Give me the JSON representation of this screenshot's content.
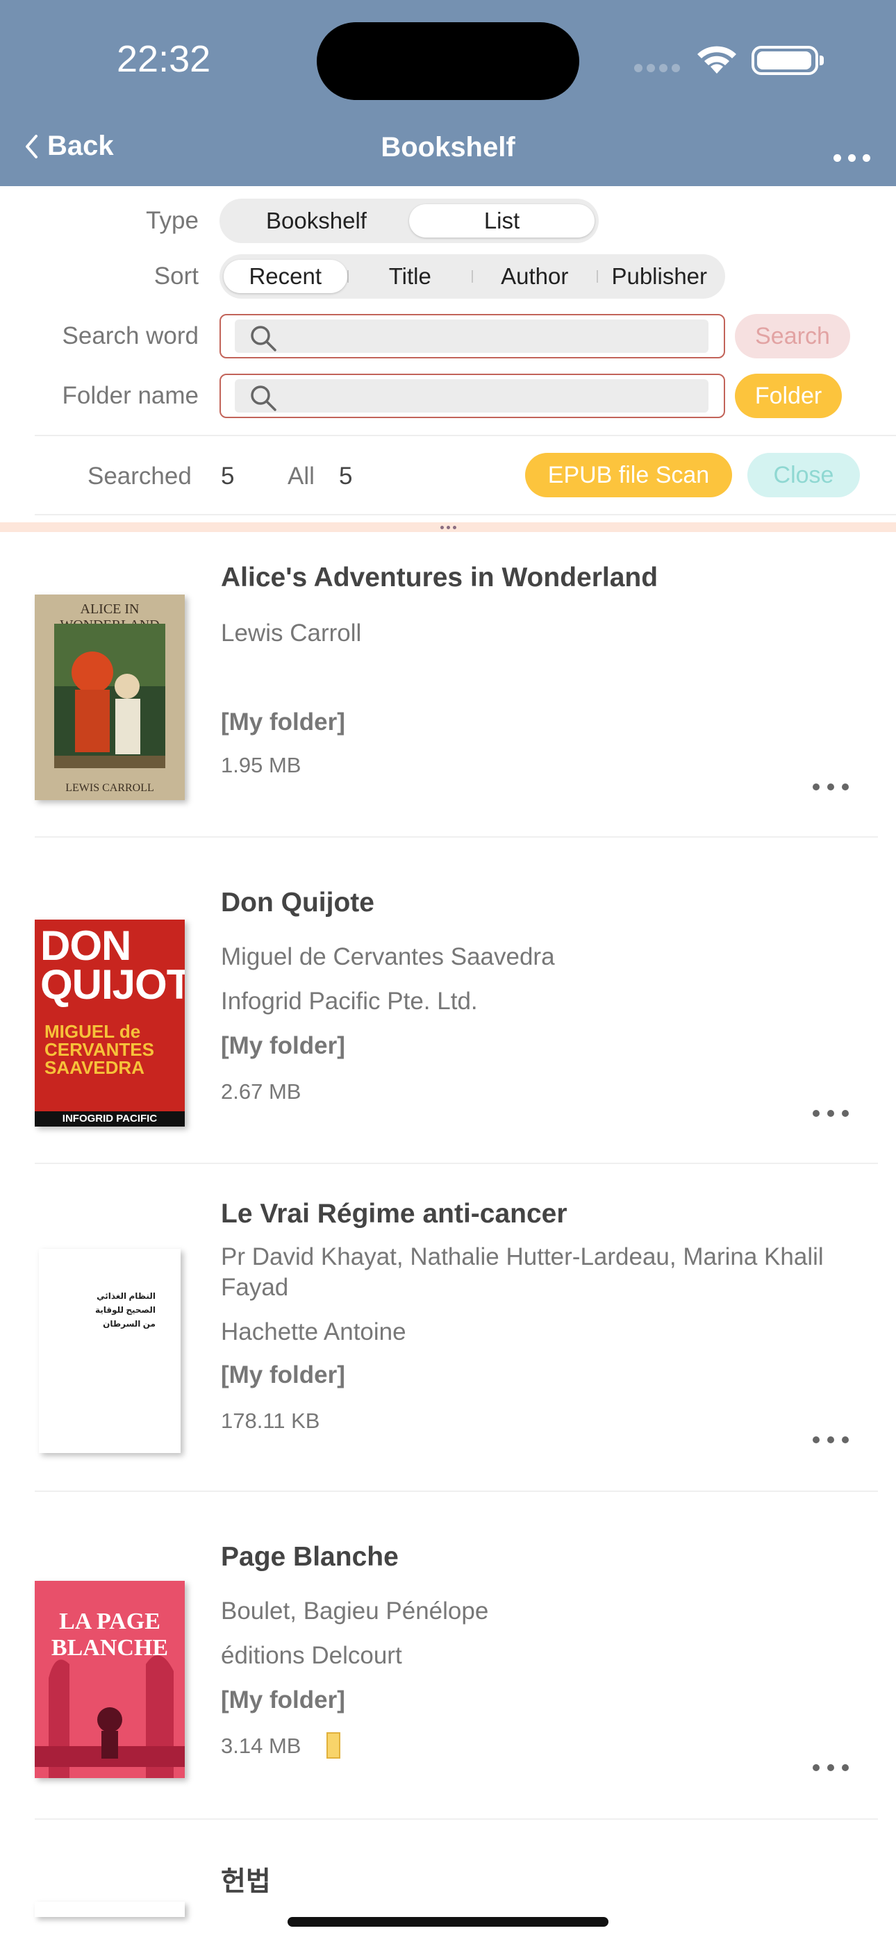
{
  "status": {
    "time": "22:32"
  },
  "nav": {
    "back_label": "Back",
    "title": "Bookshelf"
  },
  "filters": {
    "type_label": "Type",
    "type_options": [
      "Bookshelf",
      "List"
    ],
    "type_selected": "List",
    "sort_label": "Sort",
    "sort_options": [
      "Recent",
      "Title",
      "Author",
      "Publisher"
    ],
    "sort_selected": "Recent",
    "search_word_label": "Search word",
    "search_word_value": "",
    "search_button": "Search",
    "folder_name_label": "Folder name",
    "folder_name_value": "",
    "folder_button": "Folder"
  },
  "counts": {
    "searched_label": "Searched",
    "searched_value": "5",
    "all_label": "All",
    "all_value": "5",
    "epub_scan_button": "EPUB file Scan",
    "close_button": "Close"
  },
  "books": [
    {
      "title": "Alice's Adventures in Wonderland",
      "author": "Lewis Carroll",
      "publisher": "",
      "folder": "[My folder]",
      "size": "1.95 MB",
      "cover_top_text": "ALICE IN WONDERLAND",
      "cover_bottom_text": "LEWIS CARROLL"
    },
    {
      "title": "Don Quijote",
      "author": "Miguel de Cervantes Saavedra",
      "publisher": "Infogrid Pacific Pte. Ltd.",
      "folder": "[My folder]",
      "size": "2.67 MB",
      "cover_big": "DON QUIJOTE",
      "cover_sub": "MIGUEL de CERVANTES SAAVEDRA",
      "cover_band": "INFOGRID PACIFIC"
    },
    {
      "title": "Le Vrai Régime anti-cancer",
      "author": "Pr David Khayat, Nathalie Hutter-Lardeau, Marina Khalil Fayad",
      "publisher": "Hachette Antoine",
      "folder": "[My folder]",
      "size": "178.11 KB",
      "cover_text": "النظام الغذائي الصحيح للوقاية من السرطان"
    },
    {
      "title": "Page Blanche",
      "author": "Boulet, Bagieu Pénélope",
      "publisher": "éditions Delcourt",
      "folder": "[My folder]",
      "size": "3.14 MB",
      "cover_text": "LA PAGE BLANCHE"
    },
    {
      "title": "헌법"
    }
  ],
  "colors": {
    "header": "#7591b1",
    "accent_yellow": "#fcc43d",
    "input_border": "#c2645a"
  }
}
